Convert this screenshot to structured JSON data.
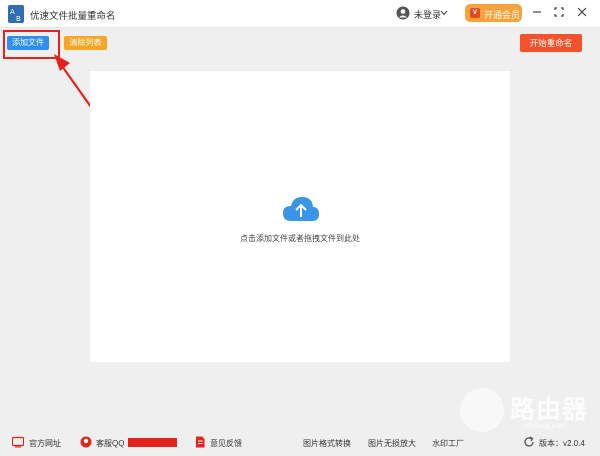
{
  "app": {
    "title": "优速文件批量重命名"
  },
  "account": {
    "login_label": "未登录",
    "vip_label": "开通会员"
  },
  "toolbar": {
    "add_label": "添加文件",
    "clear_label": "清除列表",
    "start_label": "开始重命名"
  },
  "dropzone": {
    "hint": "点击添加文件或者拖拽文件到此处"
  },
  "footer": {
    "website": "官方网址",
    "support": "客服QQ",
    "feedback": "意见反馈",
    "format": "图片格式转换",
    "enlarge": "图片无损放大",
    "watermark_tool": "水印工厂",
    "version": "版本：v2.0.4"
  },
  "overlay": {
    "brand": "路由器",
    "domain": "luyouqi.com"
  },
  "colors": {
    "accent_blue": "#2e8ff0",
    "accent_orange": "#f6a623",
    "start_red": "#f4522a",
    "highlight_red": "#e5231d"
  }
}
